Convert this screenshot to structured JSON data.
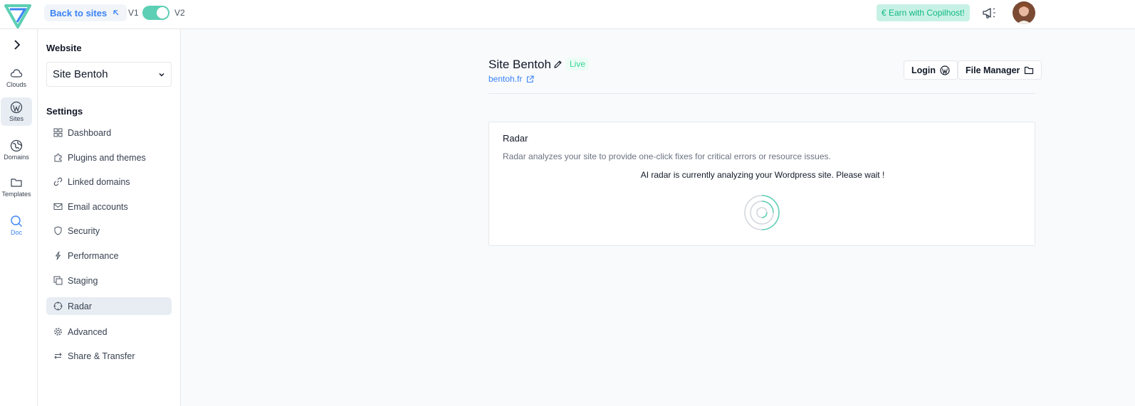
{
  "topbar": {
    "back_label": "Back to sites",
    "version_left": "V1",
    "version_right": "V2",
    "version_toggle_on": true,
    "earn_label": "€ Earn with Copilhost!"
  },
  "rail": {
    "items": [
      {
        "label": "Clouds",
        "icon": "cloud-icon"
      },
      {
        "label": "Sites",
        "icon": "wordpress-icon"
      },
      {
        "label": "Domains",
        "icon": "globe-icon"
      },
      {
        "label": "Templates",
        "icon": "folder-icon"
      },
      {
        "label": "Doc",
        "icon": "search-icon"
      }
    ]
  },
  "sidebar": {
    "website_heading": "Website",
    "selected_site": "Site Bentoh",
    "settings_heading": "Settings",
    "items": [
      {
        "label": "Dashboard",
        "icon": "dashboard-icon"
      },
      {
        "label": "Plugins and themes",
        "icon": "puzzle-icon"
      },
      {
        "label": "Linked domains",
        "icon": "link-icon"
      },
      {
        "label": "Email accounts",
        "icon": "mail-icon"
      },
      {
        "label": "Security",
        "icon": "shield-icon"
      },
      {
        "label": "Performance",
        "icon": "bolt-icon"
      },
      {
        "label": "Staging",
        "icon": "copy-icon"
      },
      {
        "label": "Radar",
        "icon": "crosshair-icon"
      },
      {
        "label": "Advanced",
        "icon": "gear-icon"
      },
      {
        "label": "Share & Transfer",
        "icon": "transfer-icon"
      }
    ]
  },
  "main": {
    "site_name": "Site Bentoh",
    "status_badge": "Live",
    "site_url": "bentoh.fr",
    "login_label": "Login",
    "file_manager_label": "File Manager",
    "radar": {
      "title": "Radar",
      "description": "Radar analyzes your site to provide one-click fixes for critical errors or resource issues.",
      "wait_message": "AI radar is currently analyzing your Wordpress site. Please wait !"
    }
  },
  "colors": {
    "accent_teal": "#5ccfb4",
    "link_blue": "#3b82f6",
    "live_green": "#34d399"
  }
}
